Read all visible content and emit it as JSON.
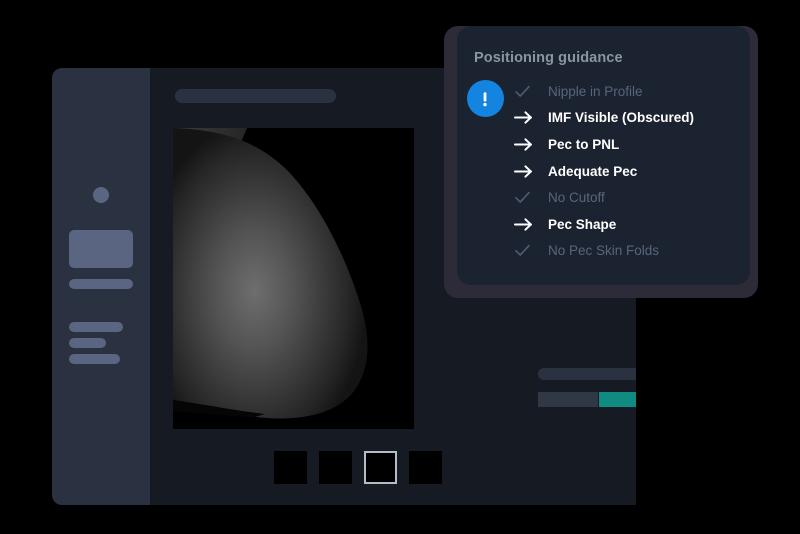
{
  "device": {
    "sidebar": {
      "avatar": "user-avatar-dot",
      "card": "nav-card-block",
      "bars": [
        "nav-bar-primary",
        "nav-bar-a",
        "nav-bar-b",
        "nav-bar-c"
      ]
    },
    "header": {
      "pill": "header-title-placeholder"
    },
    "viewport": {
      "label": "mammogram-image",
      "background": "#000000"
    },
    "controls": {
      "pill": "control-bar-placeholder",
      "segments": [
        {
          "name": "segment-1",
          "active": false,
          "color": "#303845"
        },
        {
          "name": "segment-2",
          "active": true,
          "color": "#0f8b82"
        },
        {
          "name": "segment-3",
          "active": false,
          "color": "#303845"
        }
      ]
    },
    "thumbnails": [
      {
        "name": "thumbnail-1",
        "selected": false
      },
      {
        "name": "thumbnail-2",
        "selected": false
      },
      {
        "name": "thumbnail-3",
        "selected": true
      },
      {
        "name": "thumbnail-4",
        "selected": false
      }
    ]
  },
  "panel": {
    "title": "Positioning guidance",
    "alert": {
      "icon": "exclamation-circle-icon",
      "color": "#1384e0"
    },
    "colors": {
      "panel_bg": "#1b2230",
      "shadow": "#2e2b38",
      "pass_text": "#57677a",
      "action_text": "#ffffff",
      "teal": "#0f8b82",
      "blue": "#1384e0"
    },
    "items": [
      {
        "label": "Nipple in Profile",
        "status": "pass",
        "icon": "check-icon"
      },
      {
        "label": "IMF Visible (Obscured)",
        "status": "action",
        "icon": "arrow-right-icon"
      },
      {
        "label": "Pec to PNL",
        "status": "action",
        "icon": "arrow-right-icon"
      },
      {
        "label": "Adequate Pec",
        "status": "action",
        "icon": "arrow-right-icon"
      },
      {
        "label": "No Cutoff",
        "status": "pass",
        "icon": "check-icon"
      },
      {
        "label": "Pec Shape",
        "status": "action",
        "icon": "arrow-right-icon"
      },
      {
        "label": "No Pec Skin Folds",
        "status": "pass",
        "icon": "check-icon"
      }
    ]
  }
}
